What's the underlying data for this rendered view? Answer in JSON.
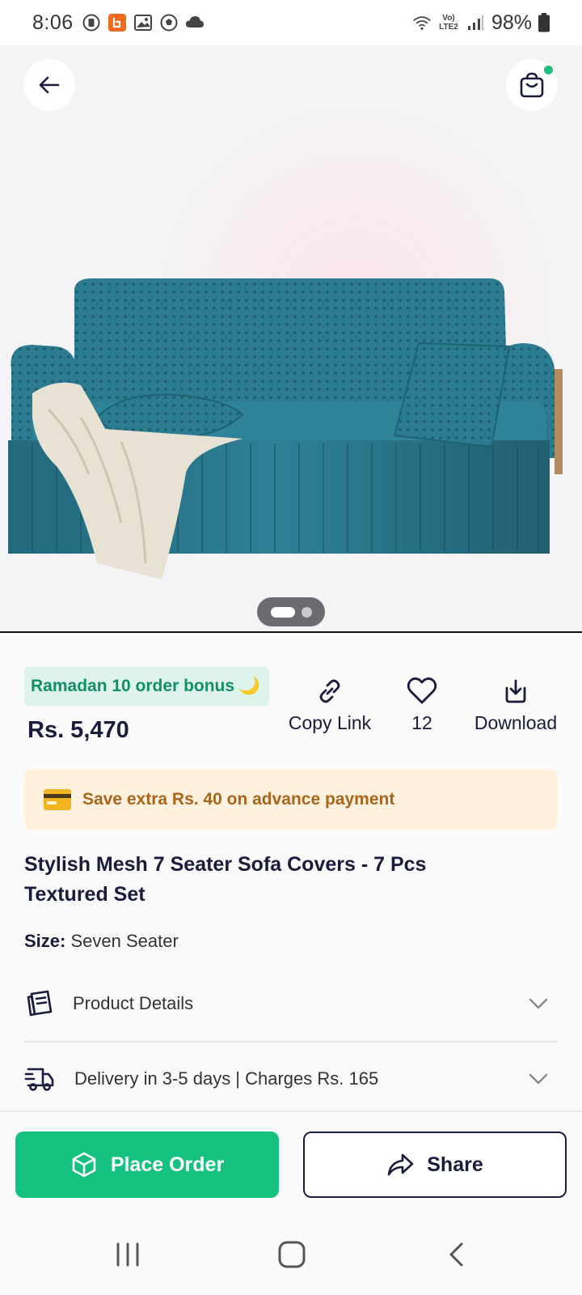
{
  "status_bar": {
    "time": "8:06",
    "battery": "98%",
    "network": "Vo) LTE2"
  },
  "header": {
    "back_icon": "arrow-left-icon",
    "cart_icon": "shopping-bag-icon",
    "cart_has_badge": true
  },
  "gallery": {
    "total_images": 2,
    "active_index": 0
  },
  "promo": {
    "bonus_label": "Ramadan 10 order bonus 🌙",
    "price": "Rs. 5,470"
  },
  "actions": {
    "copy_link": "Copy Link",
    "likes": "12",
    "download": "Download"
  },
  "advance": {
    "icon": "credit-card-icon",
    "text": "Save extra Rs. 40 on advance payment"
  },
  "product": {
    "title": "Stylish Mesh 7 Seater Sofa Covers - 7 Pcs Textured Set",
    "size_key": "Size:",
    "size_value": "Seven Seater"
  },
  "accordion": {
    "details_label": "Product Details",
    "delivery_label": "Delivery in 3-5 days | Charges Rs. 165"
  },
  "footer": {
    "place_order": "Place Order",
    "share": "Share"
  },
  "colors": {
    "accent_green": "#14c17e",
    "navy": "#1a1c3d",
    "advance_bg": "#fff1de",
    "advance_text": "#a8651c",
    "bonus_bg": "#def3ea",
    "bonus_text": "#129063"
  }
}
